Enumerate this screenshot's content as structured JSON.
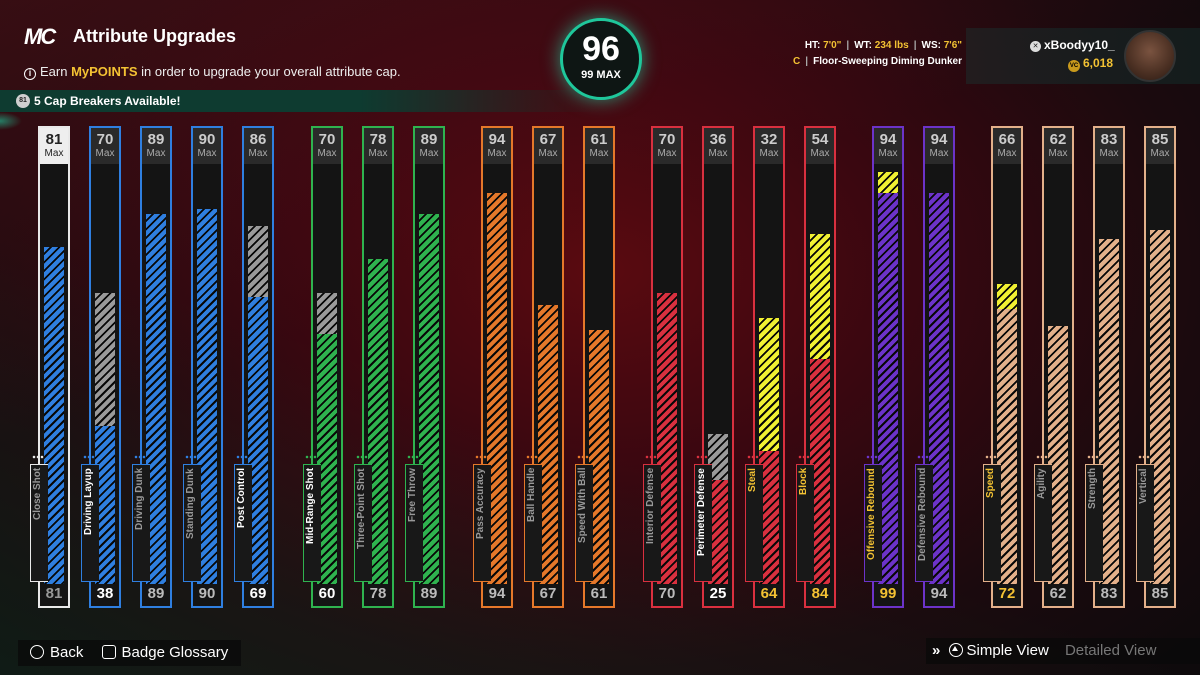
{
  "header": {
    "logo": "MC",
    "title": "Attribute Upgrades",
    "subtitle_pre": "Earn ",
    "subtitle_hl": "MyPOINTS",
    "subtitle_post": " in order to upgrade your overall attribute cap.",
    "cap_breakers": "5 Cap Breakers Available!",
    "cap_icon": "81"
  },
  "overall": {
    "value": "96",
    "max": "99 MAX"
  },
  "player": {
    "ht_label": "HT:",
    "ht": "7'0\"",
    "wt_label": "WT:",
    "wt": "234 lbs",
    "ws_label": "WS:",
    "ws": "7'6\"",
    "position": "C",
    "build": "Floor-Sweeping Diming Dunker",
    "gamertag": "xBoodyy10_",
    "vc": "6,018"
  },
  "attributes": [
    {
      "name": "Close Shot",
      "current": 81,
      "max": 81,
      "group": "white",
      "max_label": "Max"
    },
    {
      "name": "Driving Layup",
      "current": 38,
      "max": 70,
      "group": "blue",
      "max_label": "Max"
    },
    {
      "name": "Driving Dunk",
      "current": 89,
      "max": 89,
      "group": "blue",
      "max_label": "Max"
    },
    {
      "name": "Standing Dunk",
      "current": 90,
      "max": 90,
      "group": "blue",
      "max_label": "Max"
    },
    {
      "name": "Post Control",
      "current": 69,
      "max": 86,
      "group": "blue",
      "max_label": "Max"
    },
    {
      "name": "Mid-Range Shot",
      "current": 60,
      "max": 70,
      "group": "green",
      "max_label": "Max"
    },
    {
      "name": "Three-Point Shot",
      "current": 78,
      "max": 78,
      "group": "green",
      "max_label": "Max"
    },
    {
      "name": "Free Throw",
      "current": 89,
      "max": 89,
      "group": "green",
      "max_label": "Max"
    },
    {
      "name": "Pass Accuracy",
      "current": 94,
      "max": 94,
      "group": "orange",
      "max_label": "Max"
    },
    {
      "name": "Ball Handle",
      "current": 67,
      "max": 67,
      "group": "orange",
      "max_label": "Max"
    },
    {
      "name": "Speed With Ball",
      "current": 61,
      "max": 61,
      "group": "orange",
      "max_label": "Max"
    },
    {
      "name": "Interior Defense",
      "current": 70,
      "max": 70,
      "group": "red",
      "max_label": "Max"
    },
    {
      "name": "Perimeter Defense",
      "current": 25,
      "max": 36,
      "group": "red",
      "max_label": "Max"
    },
    {
      "name": "Steal",
      "current": 64,
      "max": 32,
      "group": "red",
      "max_label": "Max",
      "highlight": true
    },
    {
      "name": "Block",
      "current": 84,
      "max": 54,
      "group": "red",
      "max_label": "Max",
      "highlight": true
    },
    {
      "name": "Offensive Rebound",
      "current": 99,
      "max": 94,
      "group": "purple",
      "max_label": "Max",
      "highlight": true
    },
    {
      "name": "Defensive Rebound",
      "current": 94,
      "max": 94,
      "group": "purple",
      "max_label": "Max"
    },
    {
      "name": "Speed",
      "current": 72,
      "max": 66,
      "group": "tan",
      "max_label": "Max",
      "highlight": true
    },
    {
      "name": "Agility",
      "current": 62,
      "max": 62,
      "group": "tan",
      "max_label": "Max"
    },
    {
      "name": "Strength",
      "current": 83,
      "max": 83,
      "group": "tan",
      "max_label": "Max"
    },
    {
      "name": "Vertical",
      "current": 85,
      "max": 85,
      "group": "tan",
      "max_label": "Max"
    }
  ],
  "colors": {
    "white": "#e9e9e9",
    "blue": "#2f7fe0",
    "green": "#2fb34f",
    "orange": "#e5782a",
    "red": "#d9303f",
    "purple": "#6c33c9",
    "tan": "#e3b08a",
    "boost": "#f0f032",
    "gray": "#9a9a9a",
    "accent": "#1fc79b",
    "gold": "#f3c233"
  },
  "footer": {
    "back": "Back",
    "badge_glossary": "Badge Glossary",
    "simple_view": "Simple View",
    "detailed_view": "Detailed View"
  }
}
